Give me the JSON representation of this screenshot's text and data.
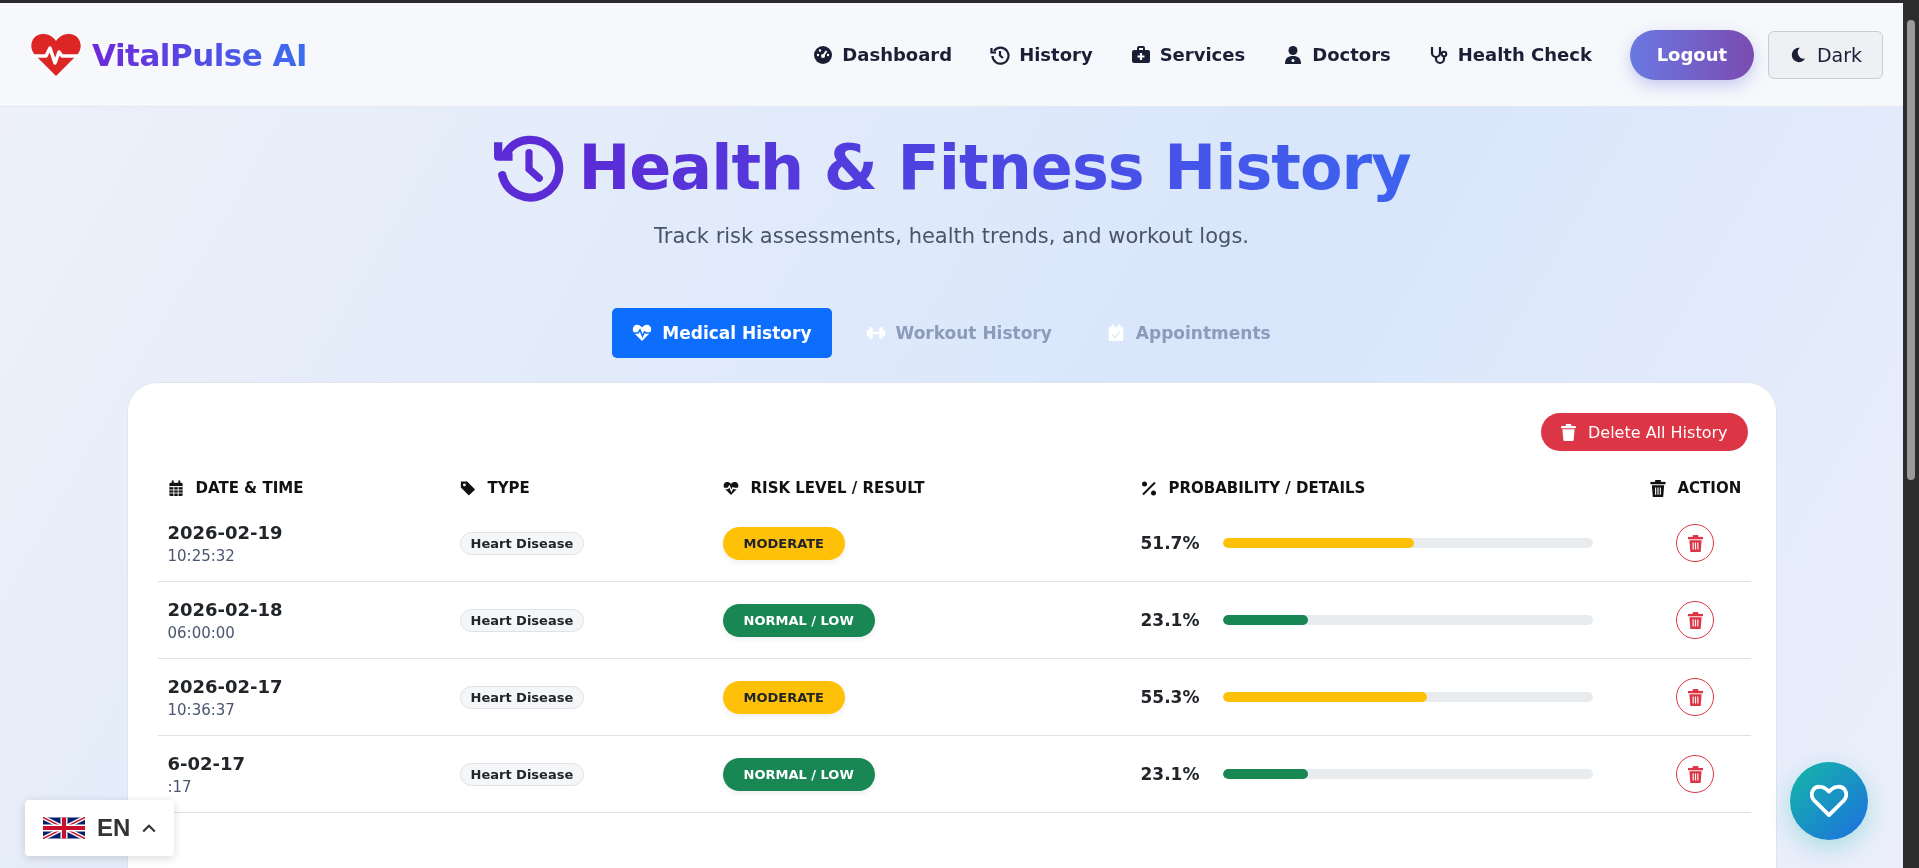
{
  "brand": {
    "name": "VitalPulse AI"
  },
  "nav": [
    {
      "label": "Dashboard"
    },
    {
      "label": "History"
    },
    {
      "label": "Services"
    },
    {
      "label": "Doctors"
    },
    {
      "label": "Health Check"
    }
  ],
  "logout": "Logout",
  "theme_toggle": "Dark",
  "page": {
    "title": "Health & Fitness History",
    "subtitle": "Track risk assessments, health trends, and workout logs."
  },
  "tabs": [
    {
      "label": "Medical History",
      "selected": true
    },
    {
      "label": "Workout History",
      "selected": false
    },
    {
      "label": "Appointments",
      "selected": false
    }
  ],
  "delete_all": "Delete All History",
  "table": {
    "columns": [
      "DATE & TIME",
      "TYPE",
      "RISK LEVEL / RESULT",
      "PROBABILITY / DETAILS",
      "ACTION"
    ],
    "rows": [
      {
        "date": "2026-02-19",
        "time": "10:25:32",
        "type": "Heart Disease",
        "risk": "MODERATE",
        "color": "#ffc107",
        "probability": "51.7%",
        "level": 0.517
      },
      {
        "date": "2026-02-18",
        "time": "06:00:00",
        "type": "Heart Disease",
        "risk": "NORMAL / LOW",
        "color": "#198754",
        "probability": "23.1%",
        "level": 0.231
      },
      {
        "date": "2026-02-17",
        "time": "10:36:37",
        "type": "Heart Disease",
        "risk": "MODERATE",
        "color": "#ffc107",
        "probability": "55.3%",
        "level": 0.553
      },
      {
        "date": "6-02-17",
        "time": ":17",
        "type": "Heart Disease",
        "risk": "NORMAL / LOW",
        "color": "#198754",
        "probability": "23.1%",
        "level": 0.231
      }
    ]
  },
  "language": {
    "code": "EN"
  }
}
